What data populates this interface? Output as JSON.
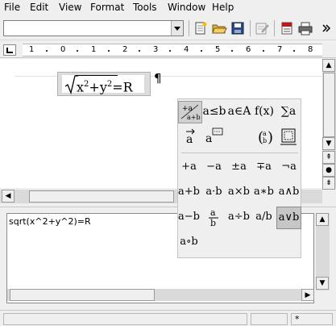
{
  "menubar": {
    "items": [
      "File",
      "Edit",
      "View",
      "Format",
      "Tools",
      "Window",
      "Help"
    ]
  },
  "toolbar": {
    "style_value": "",
    "buttons": [
      "new-icon",
      "open-icon",
      "save-icon",
      "edit-doc-icon",
      "export-pdf-icon",
      "print-icon"
    ]
  },
  "ruler": {
    "labels": [
      "1",
      "0",
      "1",
      "2",
      "3",
      "4",
      "5",
      "6",
      "7",
      "8"
    ]
  },
  "document": {
    "formula": {
      "sqrt": "√",
      "x": "x",
      "exp1": "2",
      "plus": "+",
      "y": "y",
      "exp2": "2",
      "rhs": "=R"
    },
    "pilcrow": "¶"
  },
  "elements": {
    "categories": [
      "+a/a+b",
      "a≤b",
      "a∈A",
      "f(x)",
      "∑a",
      "a⃗",
      "a💬",
      "",
      "(a b)",
      "□"
    ],
    "symbols": [
      "+a",
      "−a",
      "±a",
      "∓a",
      "¬a",
      "a+b",
      "a·b",
      "a×b",
      "a∗b",
      "a∧b",
      "a−b",
      "a/b",
      "a÷b",
      "a/b",
      "a∨b",
      "a∘b"
    ]
  },
  "command": {
    "text": "sqrt(x^2+y^2)=R"
  },
  "statusbar": {
    "modified": "*"
  },
  "colors": {
    "background": "#efefef",
    "selected": "#c6c6c6"
  }
}
